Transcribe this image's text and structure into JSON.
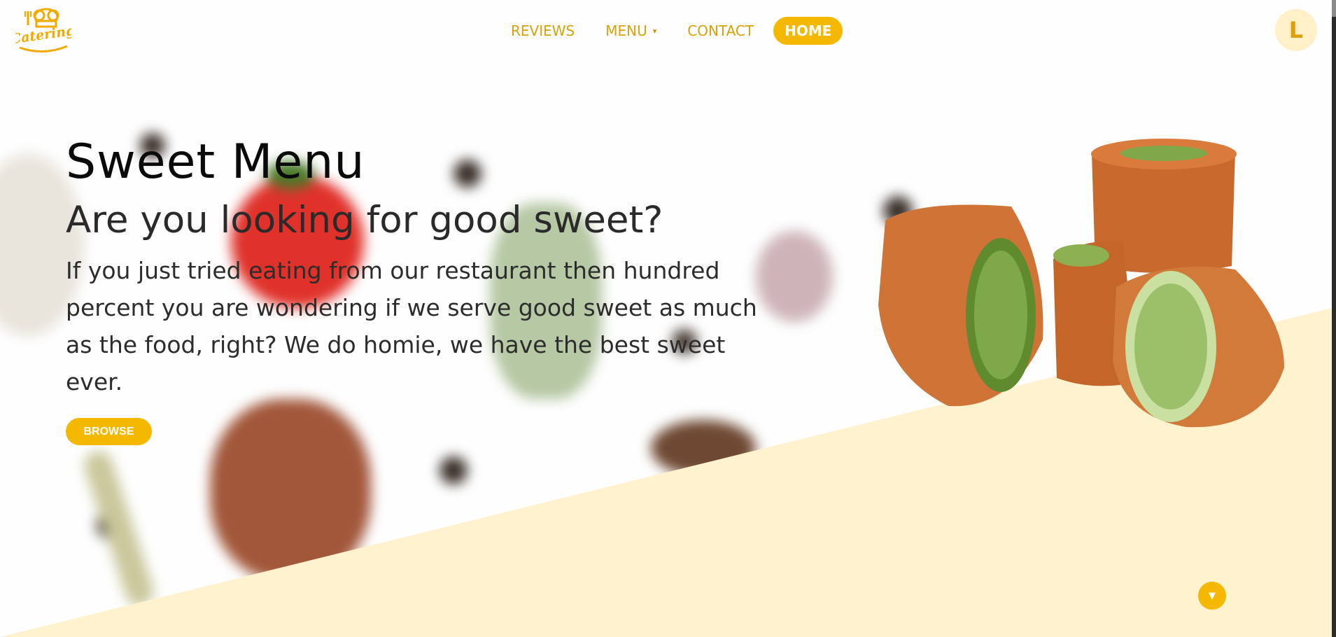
{
  "nav": {
    "logo_text": "Catering",
    "links": [
      {
        "label": "REVIEWS"
      },
      {
        "label": "MENU",
        "caret": "▾"
      },
      {
        "label": "CONTACT"
      }
    ],
    "home_label": "HOME",
    "avatar_initial": "L"
  },
  "hero": {
    "title": "Sweet Menu",
    "subtitle": "Are you looking for good sweet?",
    "description": "If you just tried eating from our restaurant then hundred percent you are wondering if we serve good sweet as much as the food, right? We do homie, we have the best sweet ever.",
    "browse_label": "BROWSE"
  },
  "scroll_down_icon": "chevron-down-icon",
  "colors": {
    "accent": "#f5b800",
    "nav_text": "#d9a20a",
    "cream": "#fff2cf"
  }
}
